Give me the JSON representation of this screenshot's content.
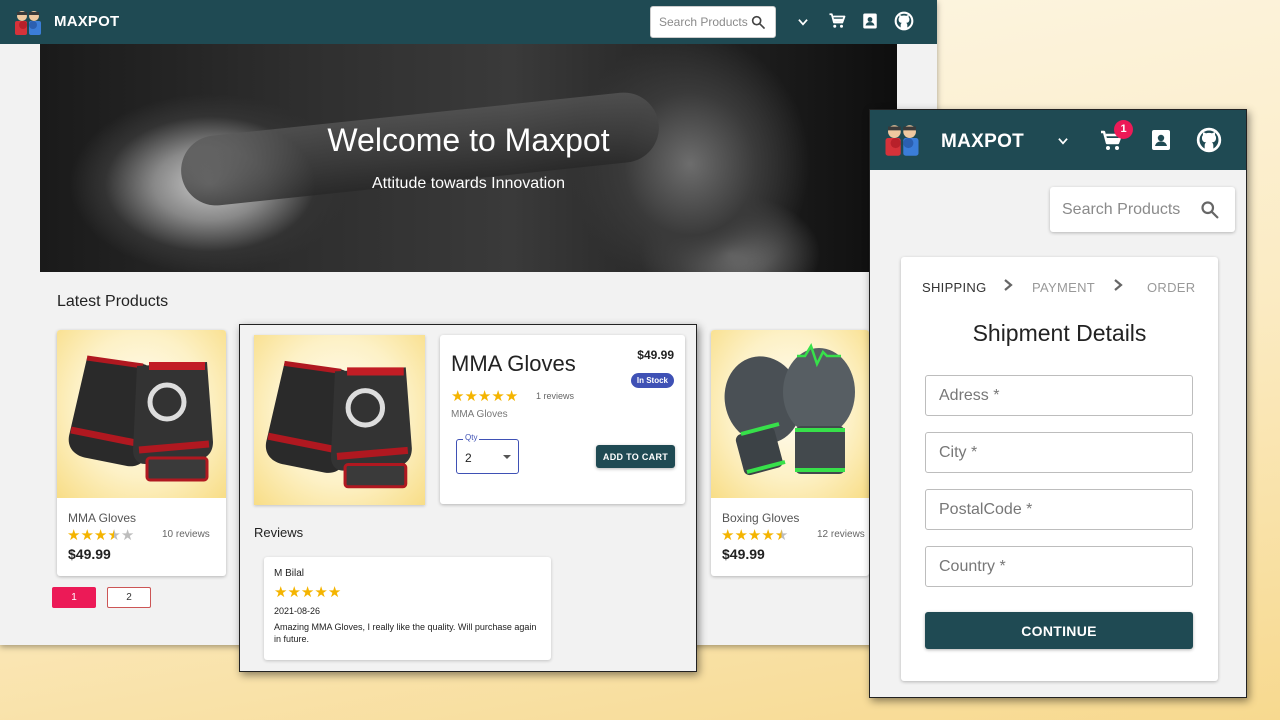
{
  "colors": {
    "navbar": "#1f4a53",
    "accent_pink": "#ec1a57",
    "star": "#f4b400",
    "in_stock_badge": "#3f51b5"
  },
  "header": {
    "brand": "MAXPOT",
    "search_placeholder": "Search Products",
    "icons": [
      "logo-boxers-icon",
      "chevron-down-icon",
      "cart-icon",
      "contact-card-icon",
      "github-icon"
    ]
  },
  "hero": {
    "title": "Welcome to Maxpot",
    "subtitle": "Attitude towards Innovation"
  },
  "latest": {
    "title": "Latest Products",
    "products": [
      {
        "name": "MMA Gloves",
        "rating": 3.5,
        "reviews": "10 reviews",
        "price": "$49.99"
      },
      {
        "name": "Boxing Gloves",
        "rating": 4.5,
        "reviews": "12 reviews",
        "price": "$49.99"
      }
    ],
    "pages": [
      "1",
      "2"
    ],
    "current_page": "1"
  },
  "detail": {
    "name": "MMA Gloves",
    "price": "$49.99",
    "stock": "In Stock",
    "rating": 5,
    "reviews": "1 reviews",
    "subtitle": "MMA Gloves",
    "qty_label": "Qty",
    "qty_value": "2",
    "add_to_cart": "ADD TO CART",
    "reviews_heading": "Reviews",
    "review": {
      "author": "M Bilal",
      "rating": 5,
      "date": "2021-08-26",
      "text": "Amazing MMA Gloves, I really like the quality. Will purchase again in future."
    }
  },
  "checkout": {
    "brand": "MAXPOT",
    "cart_count": "1",
    "search_placeholder": "Search Products",
    "steps": [
      "SHIPPING",
      "PAYMENT",
      "ORDER"
    ],
    "active_step": "SHIPPING",
    "title": "Shipment Details",
    "fields": [
      {
        "placeholder": "Adress *"
      },
      {
        "placeholder": "City *"
      },
      {
        "placeholder": "PostalCode *"
      },
      {
        "placeholder": "Country *"
      }
    ],
    "continue": "CONTINUE"
  }
}
